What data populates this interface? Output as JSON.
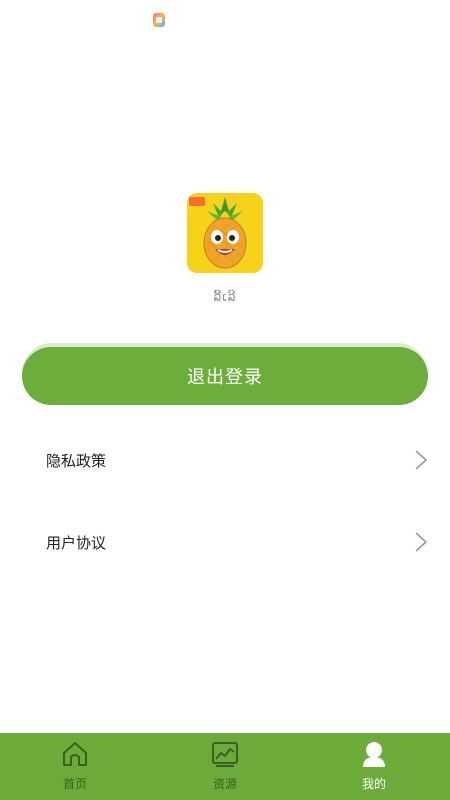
{
  "status_bar": {
    "app_icon": "app-notification-icon"
  },
  "profile": {
    "logo_icon": "pineapple-mascot-logo",
    "logo_badge": "",
    "username": "ລີ້ເລີ"
  },
  "actions": {
    "logout_label": "退出登录"
  },
  "menu": [
    {
      "label": "隐私政策",
      "icon": "chevron-right-icon"
    },
    {
      "label": "用户协议",
      "icon": "chevron-right-icon"
    }
  ],
  "tabbar": {
    "tabs": [
      {
        "label": "首页",
        "icon": "home-icon",
        "active": false
      },
      {
        "label": "资源",
        "icon": "chart-icon",
        "active": false
      },
      {
        "label": "我的",
        "icon": "user-icon",
        "active": true
      }
    ]
  },
  "colors": {
    "accent": "#6cad3b",
    "tabbar_bg": "#6cab3a",
    "tab_inactive": "#3b5f20",
    "tab_active": "#ffffff",
    "logo_bg": "#f6d21a"
  }
}
